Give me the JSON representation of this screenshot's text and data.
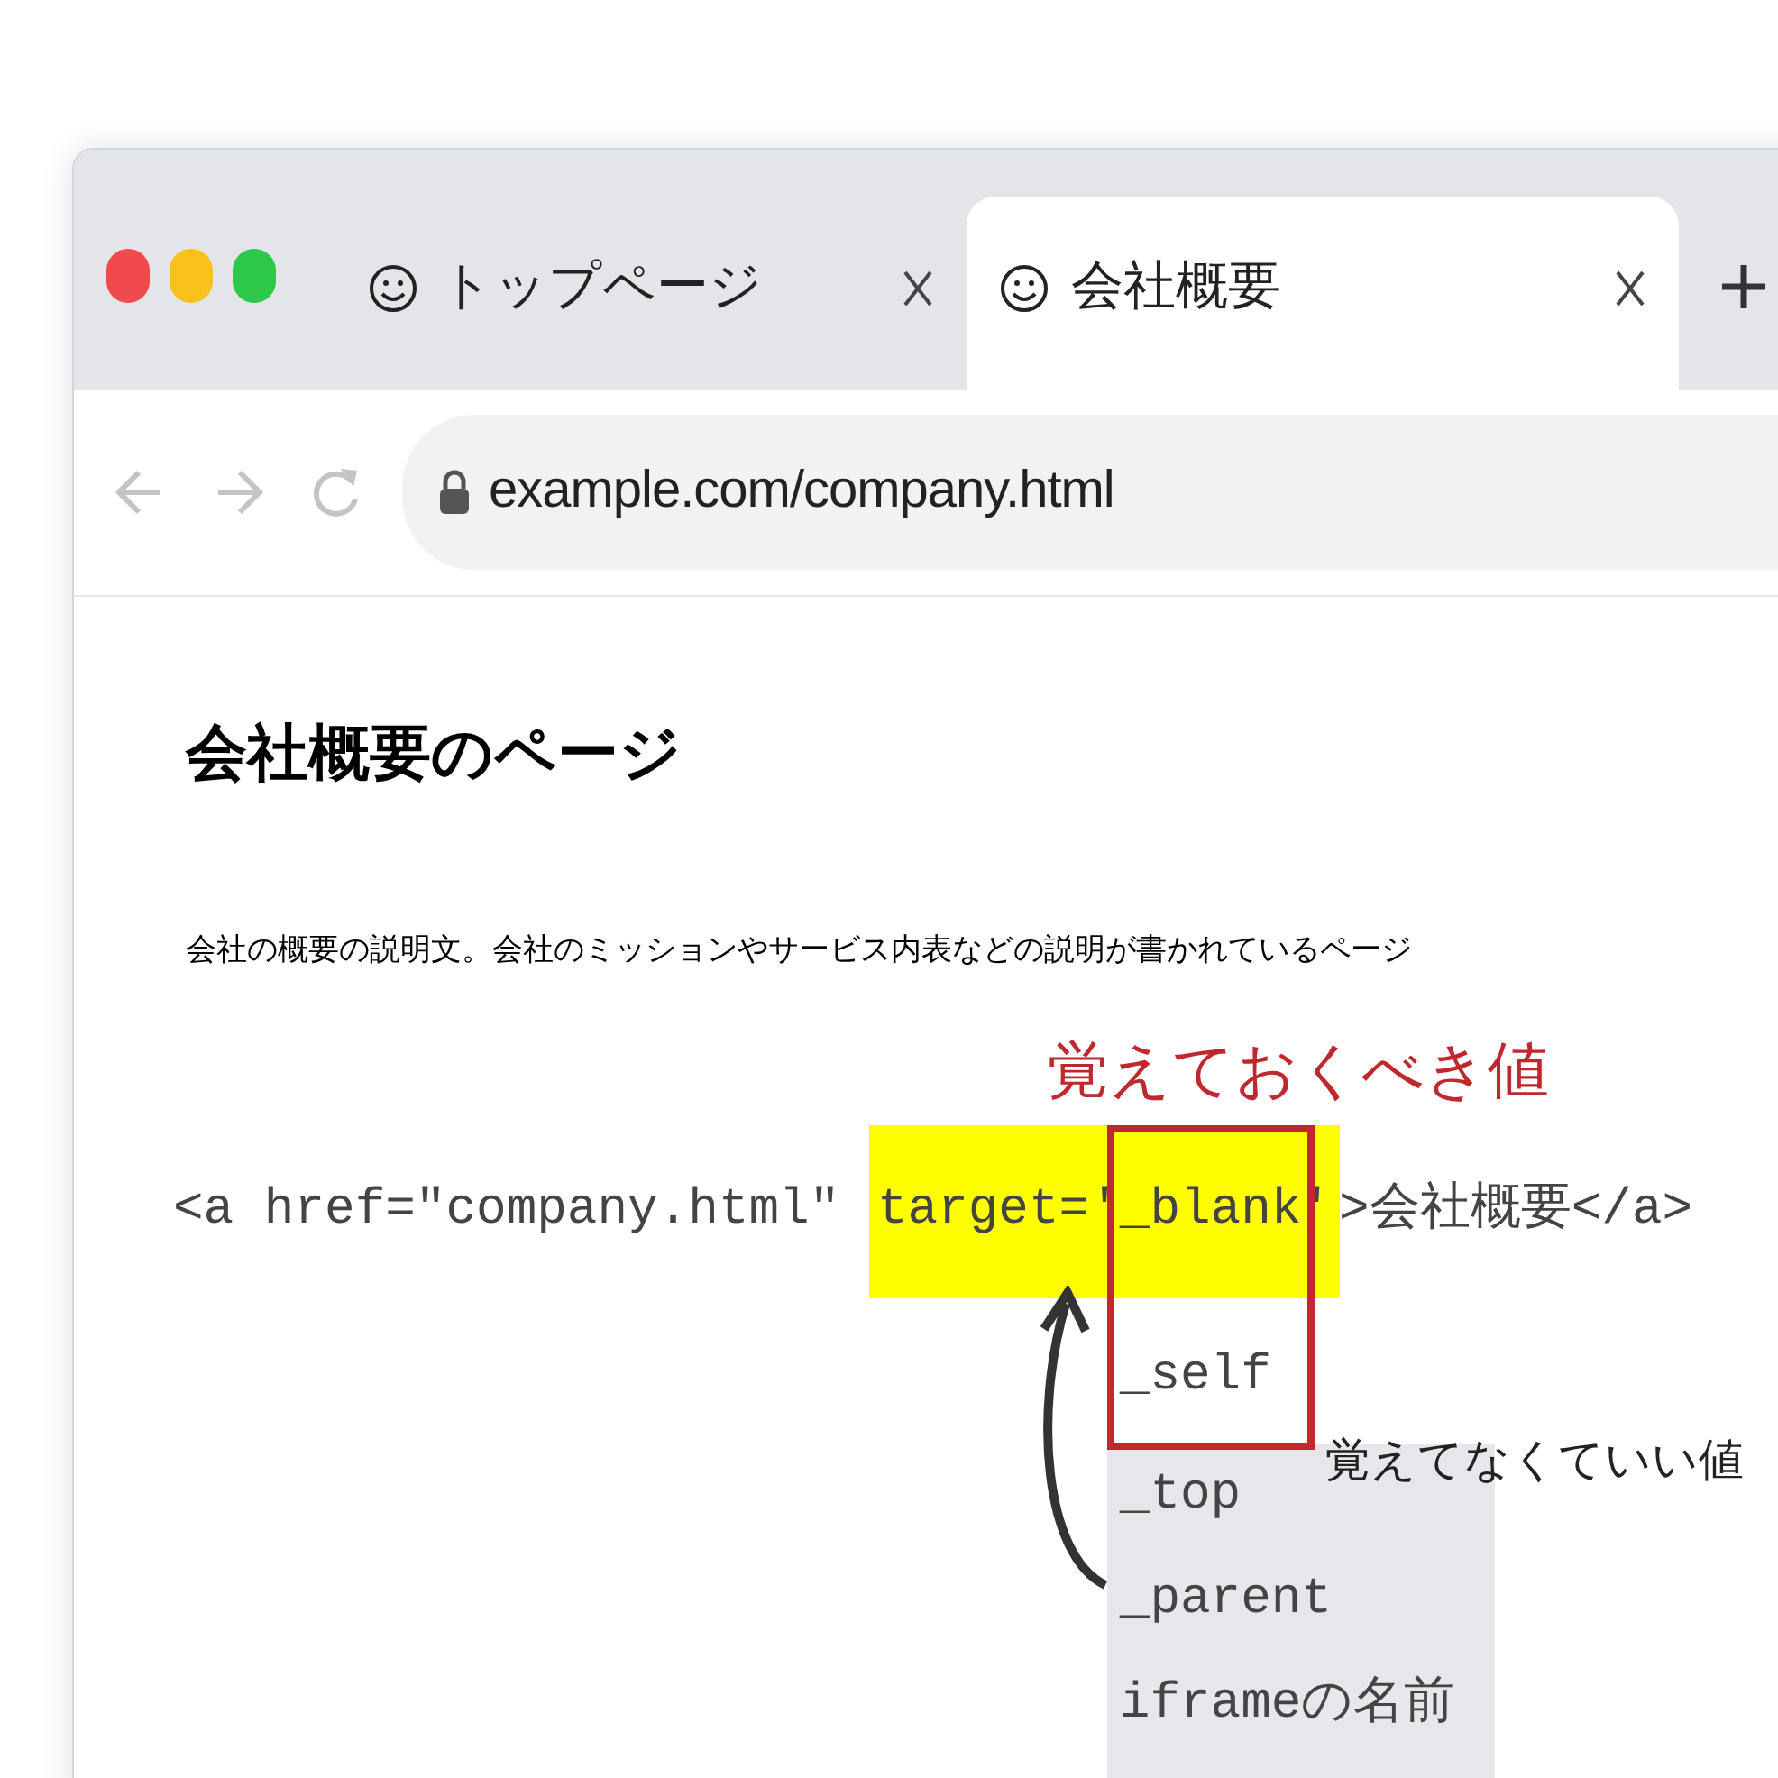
{
  "tabs": [
    {
      "label": "トップページ",
      "selected": false
    },
    {
      "label": "会社概要",
      "selected": true
    }
  ],
  "address_bar": {
    "url": "example.com/company.html"
  },
  "page": {
    "heading": "会社概要のページ",
    "description": "会社の概要の説明文。会社のミッションやサービス内表などの説明が書かれているページ"
  },
  "code": {
    "before": "<a href=\"company.html\" ",
    "attribute": "target='",
    "value": "_blank",
    "closing_quote": "'",
    "after": ">会社概要</a>"
  },
  "annotations": {
    "remember_label": "覚えておくべき値",
    "optional_label": "覚えてなくていい値",
    "remember_values": [
      "_self"
    ],
    "optional_values": [
      "_top",
      "_parent",
      "iframeの名前"
    ]
  }
}
